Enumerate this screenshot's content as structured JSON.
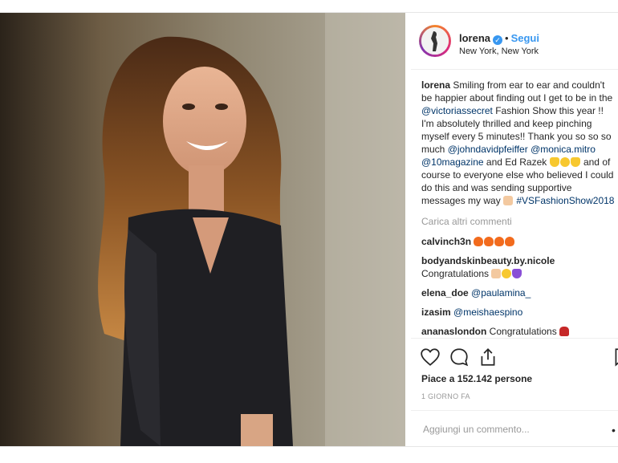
{
  "header": {
    "username": "lorena",
    "verified_icon": "verified-badge-icon",
    "separator": "•",
    "follow_label": "Segui",
    "location": "New York, New York"
  },
  "caption": {
    "user": "lorena",
    "text_1": " Smiling from ear to ear and couldn't be happier about finding out I get to be in the ",
    "mention_1": "@victoriassecret",
    "text_2": " Fashion Show this year !! I'm absolutely thrilled and keep pinching myself every 5 minutes!! Thank you so so so much ",
    "mention_2": "@johndavidpfeiffer",
    "mention_3": "@monica.mitro",
    "mention_4": "@10magazine",
    "text_3": " and Ed Razek ",
    "text_4": " and of course to everyone else who believed I could do this and was sending supportive messages my way ",
    "hashtag": "#VSFashionShow2018"
  },
  "load_more_label": "Carica altri commenti",
  "comments": [
    {
      "user": "calvinch3n",
      "text": ""
    },
    {
      "user": "bodyandskinbeauty.by.nicole",
      "text": " Congratulations "
    },
    {
      "user": "elena_doe",
      "mention": "@paulamina_"
    },
    {
      "user": "izasim",
      "mention": "@meishaespino"
    },
    {
      "user": "ananaslondon",
      "text": " Congratulations "
    }
  ],
  "actions": {
    "like_icon": "heart-outline-icon",
    "comment_icon": "comment-bubble-icon",
    "share_icon": "share-icon",
    "save_icon": "bookmark-icon"
  },
  "likes_text": "Piace a 152.142 persone",
  "timestamp": "1 GIORNO FA",
  "add_comment": {
    "placeholder": "Aggiungi un commento...",
    "more": "•"
  },
  "colors": {
    "link_blue": "#3897f0",
    "mention_blue": "#003569",
    "muted_gray": "#999999",
    "text": "#262626"
  }
}
